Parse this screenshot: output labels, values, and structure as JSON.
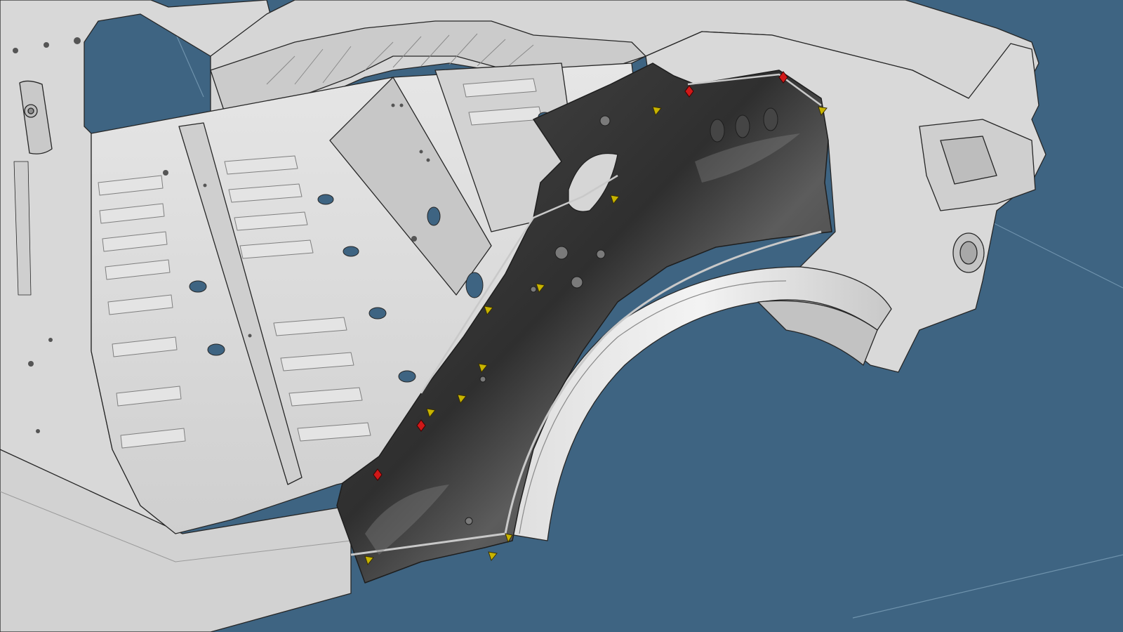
{
  "viewport": {
    "background": "#3e6482",
    "grid_line_color": "#6f93ad"
  },
  "model": {
    "body_color": "#d9d9d9",
    "body_shadow": "#a9a9a9",
    "body_highlight": "#f2f2f2",
    "edge_color": "#262626",
    "hole_color": "#3e6482",
    "panel_color": "#3a3a3a",
    "panel_highlight": "#6a6a6a",
    "flange_color": "#c4c4c4"
  },
  "markers": {
    "locator_color": "#c8b400",
    "weld_color": "#d01818",
    "locator_icon": "triangle-marker-icon",
    "weld_icon": "diamond-marker-icon"
  }
}
